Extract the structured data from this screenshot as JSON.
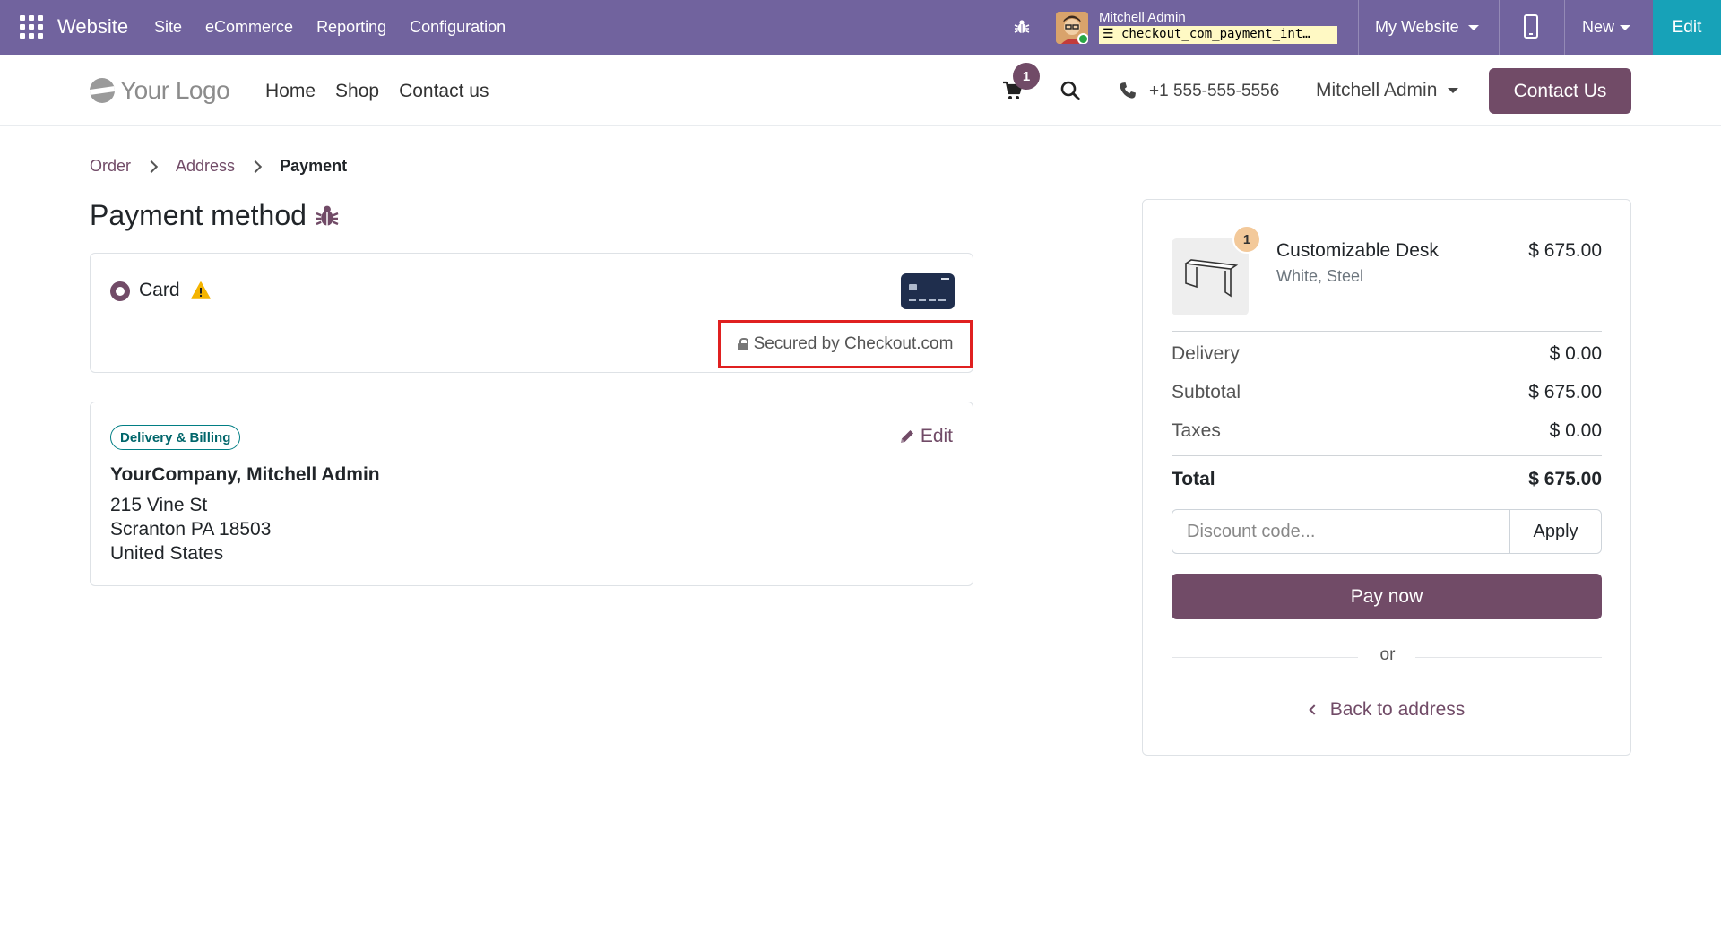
{
  "topbar": {
    "brand": "Website",
    "menu": [
      "Site",
      "eCommerce",
      "Reporting",
      "Configuration"
    ],
    "user_name": "Mitchell Admin",
    "database": "checkout_com_payment_int…",
    "my_website": "My Website",
    "new_label": "New",
    "edit_label": "Edit",
    "color": "#71639e",
    "edit_color": "#17a2b8"
  },
  "header": {
    "logo_text": "Your Logo",
    "nav": [
      "Home",
      "Shop",
      "Contact us"
    ],
    "cart_count": "1",
    "phone": "+1 555-555-5556",
    "account": "Mitchell Admin",
    "contact_button": "Contact Us",
    "brand_color": "#714b67"
  },
  "breadcrumb": {
    "items": [
      "Order",
      "Address"
    ],
    "active": "Payment"
  },
  "payment": {
    "title": "Payment method",
    "method_label": "Card",
    "secured_text": "Secured by Checkout.com"
  },
  "address": {
    "badge": "Delivery & Billing",
    "edit_label": "Edit",
    "name": "YourCompany, Mitchell Admin",
    "lines": [
      "215 Vine St",
      "Scranton PA 18503",
      "United States"
    ]
  },
  "summary": {
    "product": {
      "name": "Customizable Desk",
      "variant": "White, Steel",
      "price": "$ 675.00",
      "quantity": "1"
    },
    "rows": [
      {
        "label": "Delivery",
        "value": "$ 0.00"
      },
      {
        "label": "Subtotal",
        "value": "$ 675.00"
      },
      {
        "label": "Taxes",
        "value": "$ 0.00"
      }
    ],
    "total_label": "Total",
    "total_value": "$ 675.00",
    "discount_placeholder": "Discount code...",
    "apply_label": "Apply",
    "pay_label": "Pay now",
    "or_label": "or",
    "back_label": "Back to address"
  }
}
